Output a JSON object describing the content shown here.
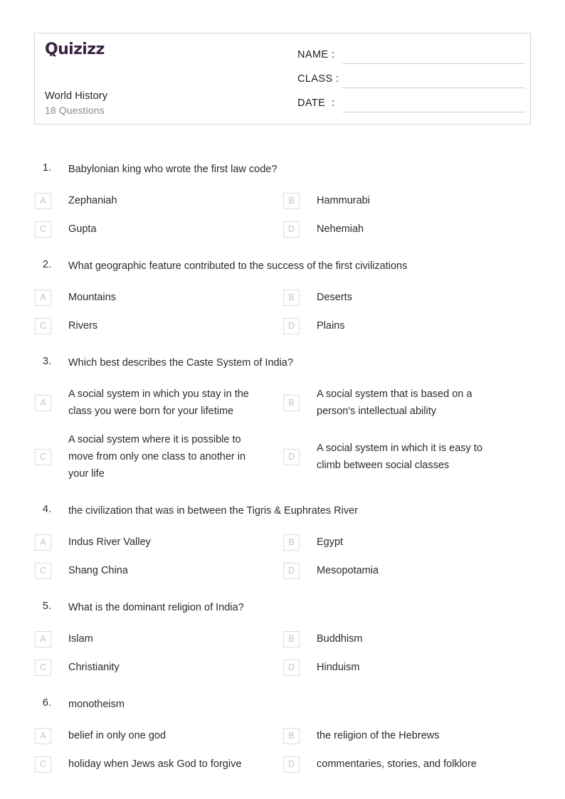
{
  "header": {
    "logo_text": "Quizizz",
    "logo_color": "#3b2342",
    "quiz_title": "World History",
    "question_count_label": "18 Questions",
    "fields": [
      {
        "label": "NAME :",
        "value": ""
      },
      {
        "label": "CLASS :",
        "value": ""
      },
      {
        "label": "DATE  :",
        "value": ""
      }
    ]
  },
  "questions": [
    {
      "number": "1.",
      "text": "Babylonian king who wrote the first law code?",
      "options": [
        {
          "letter": "A",
          "text": "Zephaniah"
        },
        {
          "letter": "B",
          "text": "Hammurabi"
        },
        {
          "letter": "C",
          "text": "Gupta"
        },
        {
          "letter": "D",
          "text": "Nehemiah"
        }
      ]
    },
    {
      "number": "2.",
      "text": "What geographic feature contributed to the success of the first civilizations",
      "options": [
        {
          "letter": "A",
          "text": "Mountains"
        },
        {
          "letter": "B",
          "text": "Deserts"
        },
        {
          "letter": "C",
          "text": "Rivers"
        },
        {
          "letter": "D",
          "text": "Plains"
        }
      ]
    },
    {
      "number": "3.",
      "text": "Which best describes the Caste System of India?",
      "options": [
        {
          "letter": "A",
          "text": "A social system in which you stay in the class you were born for your lifetime"
        },
        {
          "letter": "B",
          "text": "A social system that is based on a person's intellectual ability"
        },
        {
          "letter": "C",
          "text": "A social system where it is possible to move from only one class to another in your life"
        },
        {
          "letter": "D",
          "text": "A social system in which it is easy to climb between social classes"
        }
      ]
    },
    {
      "number": "4.",
      "text": "the civilization that was in between the Tigris & Euphrates River",
      "options": [
        {
          "letter": "A",
          "text": "Indus River Valley"
        },
        {
          "letter": "B",
          "text": "Egypt"
        },
        {
          "letter": "C",
          "text": "Shang China"
        },
        {
          "letter": "D",
          "text": "Mesopotamia"
        }
      ]
    },
    {
      "number": "5.",
      "text": "What is the dominant religion of India?",
      "options": [
        {
          "letter": "A",
          "text": "Islam"
        },
        {
          "letter": "B",
          "text": "Buddhism"
        },
        {
          "letter": "C",
          "text": "Christianity"
        },
        {
          "letter": "D",
          "text": "Hinduism"
        }
      ]
    },
    {
      "number": "6.",
      "text": "monotheism",
      "options": [
        {
          "letter": "A",
          "text": "belief in only one god"
        },
        {
          "letter": "B",
          "text": "the religion of the Hebrews"
        },
        {
          "letter": "C",
          "text": "holiday when Jews ask God to forgive"
        },
        {
          "letter": "D",
          "text": "commentaries, stories, and folklore"
        }
      ]
    }
  ]
}
